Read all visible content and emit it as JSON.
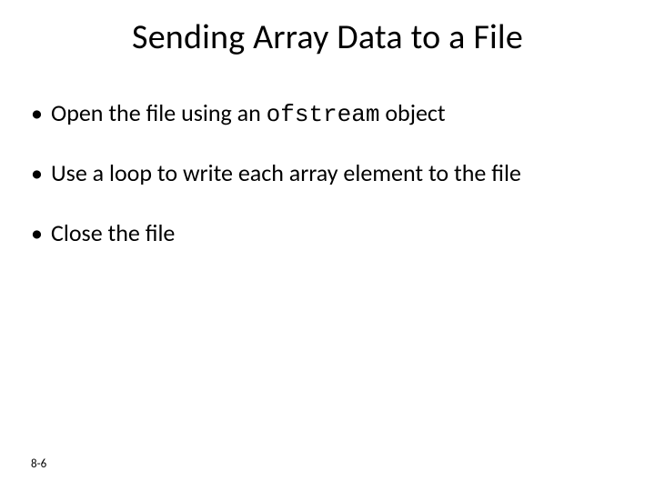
{
  "title": "Sending Array Data to a File",
  "bullets": [
    {
      "pre": "Open the file using an ",
      "code": "ofstream",
      "post": " object"
    },
    {
      "pre": "Use a loop to write each array element to the file",
      "code": "",
      "post": ""
    },
    {
      "pre": "Close the file",
      "code": "",
      "post": ""
    }
  ],
  "footer": "8-6"
}
